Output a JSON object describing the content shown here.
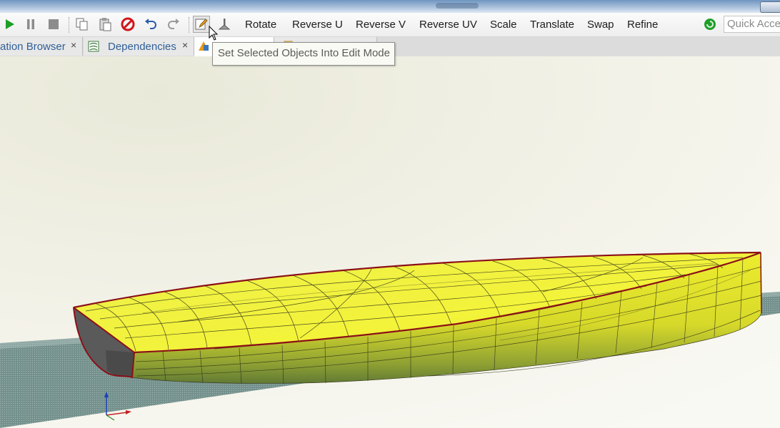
{
  "toolbar": {
    "commands": [
      "Rotate",
      "Reverse U",
      "Reverse V",
      "Reverse UV",
      "Scale",
      "Translate",
      "Swap",
      "Refine"
    ],
    "quick_access_placeholder": "Quick Access"
  },
  "tabs": [
    {
      "label": "ation Browser"
    },
    {
      "label": "Dependencies"
    },
    {
      "label": ""
    },
    {
      "label": ""
    }
  ],
  "tooltip": "Set Selected Objects Into Edit Mode",
  "icons": {
    "play": "play-icon",
    "pause": "pause-icon",
    "stop": "stop-icon",
    "copy": "copy-icon",
    "paste": "paste-icon",
    "delete": "delete-icon",
    "undo": "undo-icon",
    "redo": "redo-icon",
    "edit": "edit-pencil-icon",
    "extrude": "extrude-icon",
    "status": "status-indicator-icon"
  },
  "colors": {
    "hull": "#e9e92b",
    "edge": "#8b1018",
    "play": "#1e9e27",
    "delete": "#d0151c",
    "tab_text": "#2f5f97"
  }
}
